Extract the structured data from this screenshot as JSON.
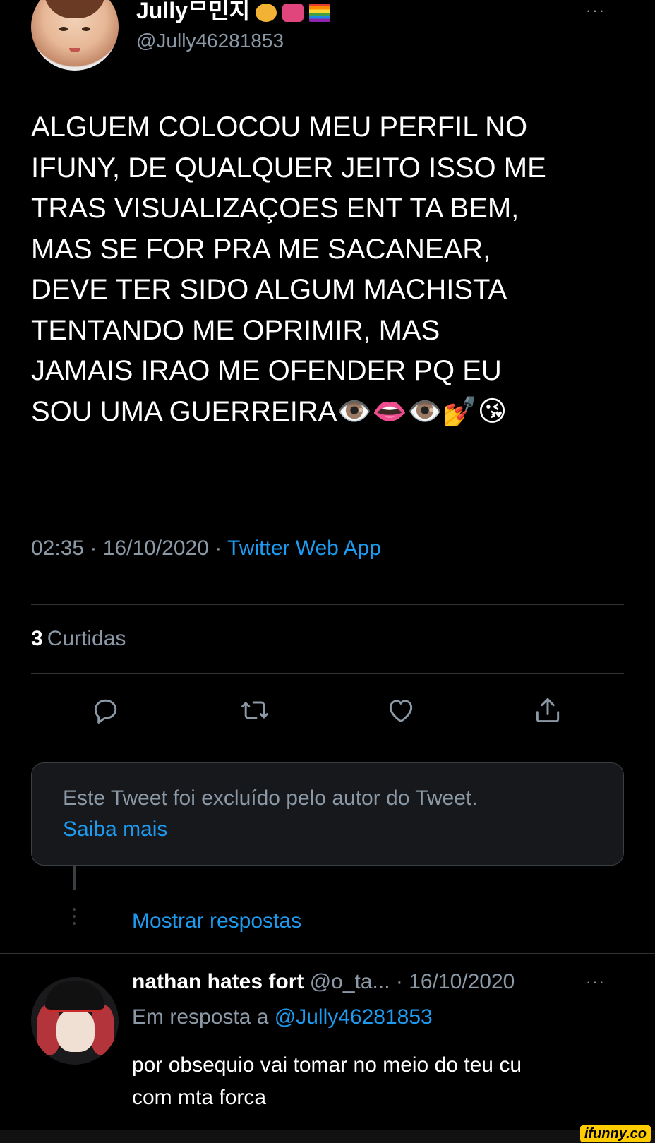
{
  "tweet": {
    "display_name": "Jullyᄆ민지",
    "handle": "@Jully46281853",
    "more": "···",
    "text": "ALGUEM COLOCOU MEU PERFIL NO\nIFUNY, DE QUALQUER JEITO ISSO ME\nTRAS VISUALIZAÇOES ENT TA BEM,\nMAS SE FOR PRA ME SACANEAR,\nDEVE TER SIDO ALGUM MACHISTA\nTENTANDO ME OPRIMIR, MAS\nJAMAIS IRAO ME OFENDER PQ EU\nSOU UMA GUERREIRA👁️👄👁️💅😘",
    "time": "02:35",
    "separator": " · ",
    "date": "16/10/2020",
    "source": "Twitter Web App",
    "likes_count": "3",
    "likes_label": "Curtidas"
  },
  "actions": [
    "reply-icon",
    "retweet-icon",
    "like-icon",
    "share-icon"
  ],
  "deleted_notice": {
    "text": "Este Tweet foi excluído pelo autor do Tweet.",
    "link": "Saiba mais"
  },
  "thread": {
    "show_replies": "Mostrar respostas"
  },
  "reply": {
    "name": "nathan hates fort",
    "rest": "@o_ta... · 16/10/2020",
    "more": "···",
    "in_reply_prefix": "Em resposta a",
    "in_reply_mention": "@Jully46281853",
    "text": "por obsequio vai tomar no meio do teu cu\ncom mta forca"
  },
  "watermark": "ifunny.co",
  "colors": {
    "background": "#000000",
    "accent": "#1d9bf0",
    "secondary_text": "#8b98a5"
  }
}
